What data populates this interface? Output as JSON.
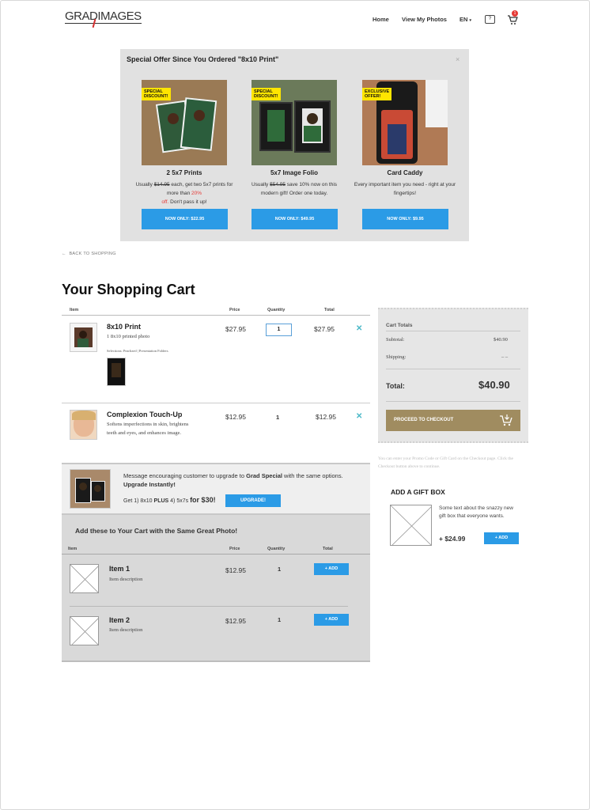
{
  "header": {
    "logo": "GRADIMAGES",
    "nav": [
      "Home",
      "View My Photos",
      "EN"
    ],
    "help_icon_text": "?",
    "cart_count": "1"
  },
  "offer": {
    "title": "Special Offer Since You Ordered \"8x10 Print\"",
    "close": "×",
    "items": [
      {
        "tag_line1": "SPECIAL",
        "tag_line2": "DISCOUNT!",
        "name": "2 5x7 Prints",
        "desc_pre": "Usually ",
        "desc_strike": "$14.95",
        "desc_mid": " each, get two 5x7 prints for more than ",
        "desc_red1": "20%",
        "desc_red2": "off.",
        "desc_post": " Don't pass it up!",
        "button": "NOW ONLY: $22.95"
      },
      {
        "tag_line1": "SPECIAL",
        "tag_line2": "DISCOUNT!",
        "name": "5x7 Image Folio",
        "desc_pre": "Usually ",
        "desc_strike": "$54.95",
        "desc_post": " save 10% now on this modern gift! Order one today.",
        "button": "NOW ONLY: $49.95"
      },
      {
        "tag_line1": "EXCLUSIVE",
        "tag_line2": "OFFER!",
        "name": "Card Caddy",
        "desc": "Every important item you need - right at your fingertips!",
        "button": "NOW ONLY: $9.95"
      }
    ]
  },
  "back_link": "BACK TO SHOPPING",
  "cart": {
    "title": "Your Shopping Cart",
    "columns": {
      "item": "Item",
      "price": "Price",
      "quantity": "Quantity",
      "total": "Total"
    },
    "items": [
      {
        "name": "8x10 Print",
        "sub": "1 8x10 printed photo",
        "selections": "Selections: Pearlized | Presentation Folders",
        "price": "$27.95",
        "qty": "1",
        "total": "$27.95",
        "remove": "✕"
      },
      {
        "name": "Complexion Touch-Up",
        "sub": "Softens imperfections in skin, brightens teeth and eyes, and enhances image.",
        "price": "$12.95",
        "qty": "1",
        "total": "$12.95",
        "remove": "✕"
      }
    ]
  },
  "upgrade": {
    "msg_pre": "Message encouraging customer to upgrade to ",
    "msg_bold": "Grad Special",
    "msg_mid": " with the same options. ",
    "msg_bold2": "Upgrade Instantly!",
    "offer_pre": "Get 1) 8x10 ",
    "offer_plus": "PLUS",
    "offer_mid": " 4) 5x7s ",
    "offer_price": "for $30!",
    "button": "UPGRADE!"
  },
  "addons": {
    "title": "Add these to Your Cart with the Same Great Photo!",
    "columns": {
      "item": "Item",
      "price": "Price",
      "quantity": "Quantity",
      "total": "Total"
    },
    "items": [
      {
        "name": "Item 1",
        "desc": "Item description",
        "price": "$12.95",
        "qty": "1",
        "button": "+ ADD"
      },
      {
        "name": "Item 2",
        "desc": "Item description",
        "price": "$12.95",
        "qty": "1",
        "button": "+ ADD"
      }
    ]
  },
  "totals": {
    "title": "Cart Totals",
    "subtotal_label": "Subtotal:",
    "subtotal": "$40.90",
    "shipping_label": "Shipping:",
    "shipping": "– –",
    "total_label": "Total:",
    "total": "$40.90",
    "checkout": "PROCEED TO CHECKOUT",
    "note": "You can enter your Promo Code or Gift Card on the Checkout page. Click the Checkout button above to continue."
  },
  "giftbox": {
    "title": "ADD A GIFT BOX",
    "desc": "Some text about the snazzy new gift box that everyone wants.",
    "price": "+ $24.99",
    "button": "+ ADD"
  }
}
